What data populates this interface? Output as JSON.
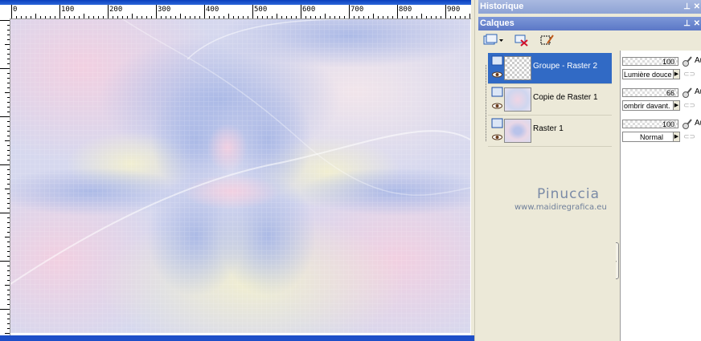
{
  "ruler": {
    "labels": [
      "0",
      "100",
      "200",
      "300",
      "400",
      "500",
      "600",
      "700",
      "800",
      "900"
    ]
  },
  "palettes": {
    "historique_title": "Historique",
    "calques_title": "Calques",
    "pin_glyph": "⊥"
  },
  "layers": [
    {
      "name": "Groupe - Raster 2",
      "opacity": "100",
      "blend": "Lumière douce",
      "selected": true
    },
    {
      "name": "Copie de Raster 1",
      "opacity": "66",
      "blend": "ombrir davant.",
      "selected": false
    },
    {
      "name": "Raster 1",
      "opacity": "100",
      "blend": "Normal",
      "selected": false
    }
  ],
  "props_cut_label": "Au",
  "watermark": {
    "name": "Pinuccia",
    "url": "www.maidiregrafica.eu"
  },
  "colors": {
    "selection": "#316ac5",
    "panel": "#ece9d8",
    "title_bar": "#5c78c7"
  },
  "icons": {
    "new_layer": "new-layer-icon",
    "delete_layer": "delete-layer-icon",
    "edit_selection": "edit-selection-icon",
    "visibility": "eye-icon",
    "lock": "lock-icon",
    "link": "link-icon"
  }
}
